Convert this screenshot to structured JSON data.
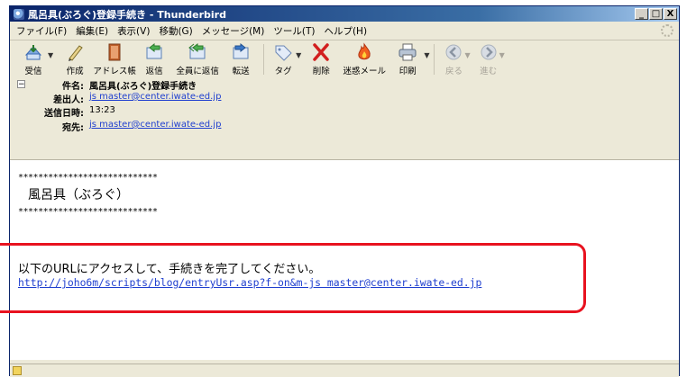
{
  "window": {
    "title": "風呂具(ぶろぐ)登録手続き - Thunderbird"
  },
  "titlebar_buttons": {
    "minimize": "_",
    "maximize": "□",
    "close": "X"
  },
  "menu": [
    "ファイル(F)",
    "編集(E)",
    "表示(V)",
    "移動(G)",
    "メッセージ(M)",
    "ツール(T)",
    "ヘルプ(H)"
  ],
  "toolbar": [
    {
      "label": "受信",
      "icon": "get-mail-icon",
      "enabled": true
    },
    {
      "label": "作成",
      "icon": "compose-icon",
      "enabled": true
    },
    {
      "label": "アドレス帳",
      "icon": "address-book-icon",
      "enabled": true
    },
    {
      "label": "返信",
      "icon": "reply-icon",
      "enabled": true
    },
    {
      "label": "全員に返信",
      "icon": "reply-all-icon",
      "enabled": true
    },
    {
      "label": "転送",
      "icon": "forward-icon",
      "enabled": true
    },
    {
      "label": "タグ",
      "icon": "tag-icon",
      "enabled": true
    },
    {
      "label": "削除",
      "icon": "delete-icon",
      "enabled": true
    },
    {
      "label": "迷惑メール",
      "icon": "junk-icon",
      "enabled": true
    },
    {
      "label": "印刷",
      "icon": "print-icon",
      "enabled": true
    },
    {
      "label": "戻る",
      "icon": "back-icon",
      "enabled": false
    },
    {
      "label": "進む",
      "icon": "forward-nav-icon",
      "enabled": false
    }
  ],
  "header": {
    "collapse_symbol": "−",
    "subject_label": "件名:",
    "subject": "風呂具(ぶろぐ)登録手続き",
    "from_label": "差出人:",
    "from": "js master@center.iwate-ed.jp",
    "date_label": "送信日時:",
    "date": "13:23",
    "to_label": "宛先:",
    "to": "js master@center.iwate-ed.jp"
  },
  "body": {
    "stars_top": "****************************",
    "blog_name": "風呂具（ぶろぐ）",
    "stars_bottom": "****************************",
    "instruction": "以下のURLにアクセスして、手続きを完了してください。",
    "url": "http://joho6m/scripts/blog/entryUsr.asp?f-on&m-js master@center.iwate-ed.jp"
  },
  "colors": {
    "highlight": "#e8121f",
    "link": "#1f3fcf",
    "titlebar": "#0a246a"
  }
}
